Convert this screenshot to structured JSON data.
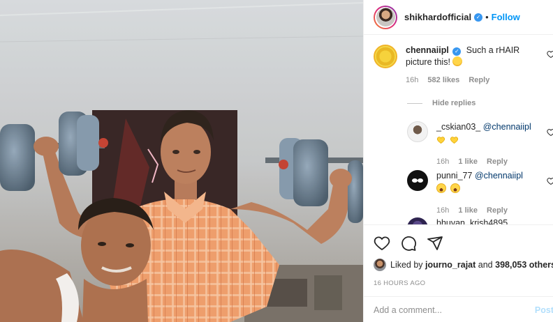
{
  "header": {
    "username": "shikhardofficial",
    "separator": "•",
    "follow_label": "Follow"
  },
  "comments": [
    {
      "username": "chennaiipl",
      "verified": true,
      "text": "Such a rHAIR picture this!",
      "emoji": "heart-eyes",
      "time": "16h",
      "likes": "582 likes",
      "reply_label": "Reply"
    }
  ],
  "hide_replies_label": "Hide replies",
  "replies": [
    {
      "username": "_cskian03_",
      "mention": "@chennaiipl",
      "emojis": [
        "yellow-heart",
        "yellow-heart"
      ],
      "time": "16h",
      "likes": "1 like",
      "reply_label": "Reply"
    },
    {
      "username": "punni_77",
      "mention": "@chennaiipl",
      "emojis": [
        "grinning-face",
        "grinning-face"
      ],
      "time": "16h",
      "likes": "1 like",
      "reply_label": "Reply"
    },
    {
      "username": "bhuvan_krish4895"
    }
  ],
  "footer": {
    "liked_prefix": "Liked by",
    "liked_user": "journo_rajat",
    "liked_and": "and",
    "liked_count": "398,053 others",
    "timestamp": "16 HOURS AGO",
    "add_comment_placeholder": "Add a comment...",
    "post_label": "Post"
  },
  "icons": [
    "heart-icon",
    "comment-icon",
    "share-icon",
    "verified-icon"
  ],
  "colors": {
    "follow": "#0095f6",
    "verified": "#3897f0",
    "mention": "#00376b",
    "muted": "#8e8e8e"
  }
}
